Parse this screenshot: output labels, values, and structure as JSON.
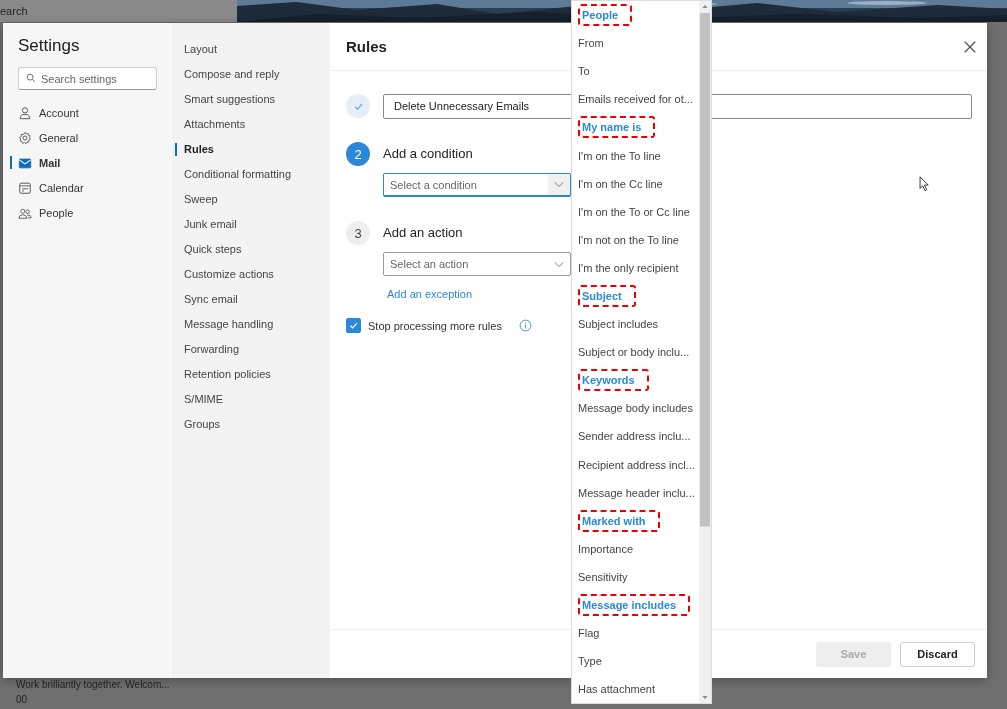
{
  "background": {
    "search_text": "earch",
    "preview_text": "Work brilliantly together. Welcom...",
    "preview_time": "00"
  },
  "settings": {
    "title": "Settings",
    "search": {
      "placeholder": "Search settings"
    },
    "categories": [
      {
        "label": "Account",
        "selected": false
      },
      {
        "label": "General",
        "selected": false
      },
      {
        "label": "Mail",
        "selected": true
      },
      {
        "label": "Calendar",
        "selected": false
      },
      {
        "label": "People",
        "selected": false
      }
    ],
    "subcategories": [
      {
        "label": "Layout",
        "selected": false
      },
      {
        "label": "Compose and reply",
        "selected": false
      },
      {
        "label": "Smart suggestions",
        "selected": false
      },
      {
        "label": "Attachments",
        "selected": false
      },
      {
        "label": "Rules",
        "selected": true
      },
      {
        "label": "Conditional formatting",
        "selected": false
      },
      {
        "label": "Sweep",
        "selected": false
      },
      {
        "label": "Junk email",
        "selected": false
      },
      {
        "label": "Quick steps",
        "selected": false
      },
      {
        "label": "Customize actions",
        "selected": false
      },
      {
        "label": "Sync email",
        "selected": false
      },
      {
        "label": "Message handling",
        "selected": false
      },
      {
        "label": "Forwarding",
        "selected": false
      },
      {
        "label": "Retention policies",
        "selected": false
      },
      {
        "label": "S/MIME",
        "selected": false
      },
      {
        "label": "Groups",
        "selected": false
      }
    ]
  },
  "panel": {
    "title": "Rules",
    "steps": [
      {
        "kind": "name",
        "done": true,
        "value": "Delete Unnecessary Emails"
      },
      {
        "kind": "select",
        "done": false,
        "active": true,
        "number": "2",
        "label": "Add a condition",
        "placeholder": "Select a condition"
      },
      {
        "kind": "select",
        "done": false,
        "active": false,
        "number": "3",
        "label": "Add an action",
        "placeholder": "Select an action"
      }
    ],
    "exception_link": "Add an exception",
    "stop_processing": {
      "label": "Stop processing more rules",
      "checked": true
    },
    "buttons": [
      {
        "label": "Save",
        "disabled": true
      },
      {
        "label": "Discard",
        "disabled": false
      }
    ]
  },
  "condition_menu": {
    "items": [
      {
        "kind": "header",
        "label": "People"
      },
      {
        "kind": "option",
        "label": "From"
      },
      {
        "kind": "option",
        "label": "To"
      },
      {
        "kind": "option",
        "label": "Emails received for ot..."
      },
      {
        "kind": "header",
        "label": "My name is"
      },
      {
        "kind": "option",
        "label": "I'm on the To line"
      },
      {
        "kind": "option",
        "label": "I'm on the Cc line"
      },
      {
        "kind": "option",
        "label": "I'm on the To or Cc line"
      },
      {
        "kind": "option",
        "label": "I'm not on the To line"
      },
      {
        "kind": "option",
        "label": "I'm the only recipient"
      },
      {
        "kind": "header",
        "label": "Subject"
      },
      {
        "kind": "option",
        "label": "Subject includes"
      },
      {
        "kind": "option",
        "label": "Subject or body inclu..."
      },
      {
        "kind": "header",
        "label": "Keywords"
      },
      {
        "kind": "option",
        "label": "Message body includes"
      },
      {
        "kind": "option",
        "label": "Sender address inclu..."
      },
      {
        "kind": "option",
        "label": "Recipient address incl..."
      },
      {
        "kind": "option",
        "label": "Message header inclu..."
      },
      {
        "kind": "header",
        "label": "Marked with"
      },
      {
        "kind": "option",
        "label": "Importance"
      },
      {
        "kind": "option",
        "label": "Sensitivity"
      },
      {
        "kind": "header",
        "label": "Message includes"
      },
      {
        "kind": "option",
        "label": "Flag"
      },
      {
        "kind": "option",
        "label": "Type"
      },
      {
        "kind": "option",
        "label": "Has attachment"
      }
    ]
  }
}
